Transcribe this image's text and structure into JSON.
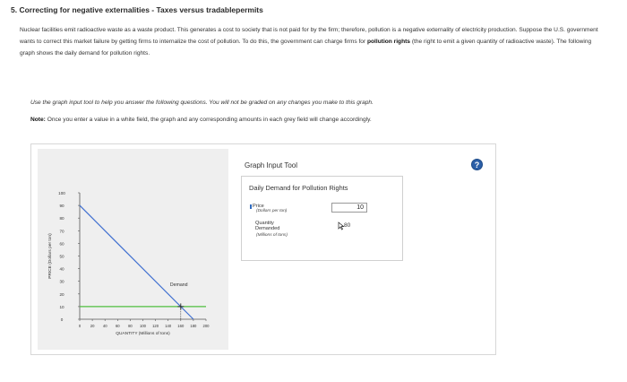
{
  "question": {
    "title": "5. Correcting for negative externalities - Taxes versus tradablepermits",
    "intro_part1": "Nuclear facilities emit radioactive waste as a waste product. This generates a cost to society that is not paid for by the firm; therefore, pollution is a negative externality of electricity production. Suppose the U.S. government wants to correct this market failure by getting firms to internalize the cost of pollution. To do this, the government can charge firms for ",
    "intro_bold": "pollution rights",
    "intro_part2": " (the right to emit a given quantity of radioactive waste). The following graph shows the daily demand for pollution rights.",
    "instruction": "Use the graph input tool to help you answer the following questions. You will not be graded on any changes you make to this graph.",
    "note_label": "Note:",
    "note_text": " Once you enter a value in a white field, the graph and any corresponding amounts in each grey field will change accordingly."
  },
  "graph_tool": {
    "title": "Graph Input Tool",
    "heading": "Daily Demand for Pollution Rights",
    "price_label": "Price",
    "price_unit": "(Dollars per ton)",
    "price_value": "10",
    "quantity_label_1": "Quantity",
    "quantity_label_2": "Demanded",
    "quantity_unit": "(Millions of tons)",
    "quantity_value": "80",
    "help_symbol": "?"
  },
  "colors": {
    "demand_line": "#3f6fd0",
    "price_line": "#4fbf3f",
    "help_icon": "#2b5fa8",
    "panel": "#efefef"
  },
  "chart_data": {
    "type": "line",
    "xlabel": "QUANTITY (Millions of tons)",
    "ylabel": "PRICE (Dollars per ton)",
    "xlim": [
      0,
      200
    ],
    "ylim": [
      0,
      100
    ],
    "xticks": [
      0,
      20,
      40,
      60,
      80,
      100,
      120,
      140,
      160,
      180,
      200
    ],
    "yticks": [
      0,
      10,
      20,
      30,
      40,
      50,
      60,
      70,
      80,
      90,
      100
    ],
    "series": [
      {
        "name": "Demand",
        "x": [
          0,
          180
        ],
        "y": [
          90,
          0
        ]
      }
    ],
    "price_line": {
      "y": 10
    },
    "marker": {
      "x": 160,
      "y": 10
    },
    "grid": false
  }
}
